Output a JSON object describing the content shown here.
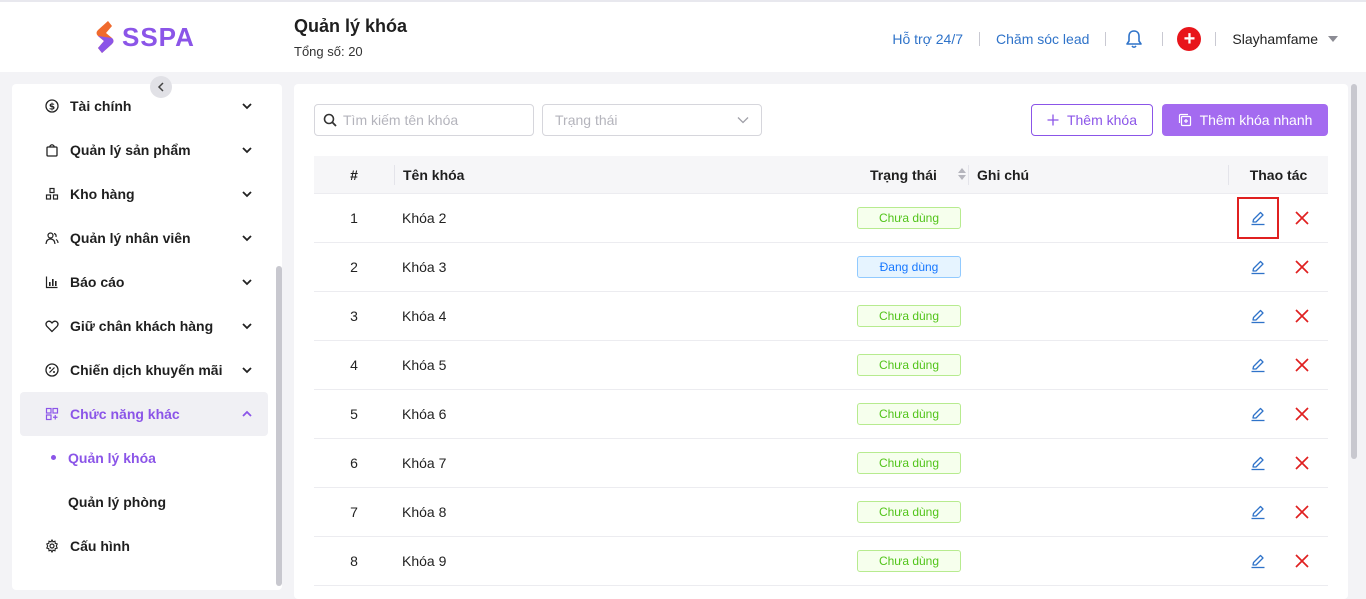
{
  "app": {
    "logo_text": "SSPA",
    "brand_color": "#8b55e8"
  },
  "header": {
    "title": "Quản lý khóa",
    "count_label": "Tổng số: 20",
    "support_link": "Hỗ trợ 24/7",
    "lead_link": "Chăm sóc lead",
    "notification_icon": "bell-icon",
    "add_icon": "plus-circle-icon",
    "user_name": "Slayhamfame"
  },
  "sidebar": {
    "items": [
      {
        "label": "Tài chính",
        "icon": "dollar-icon"
      },
      {
        "label": "Quản lý sản phẩm",
        "icon": "bag-icon"
      },
      {
        "label": "Kho hàng",
        "icon": "boxes-icon"
      },
      {
        "label": "Quản lý nhân viên",
        "icon": "users-icon"
      },
      {
        "label": "Báo cáo",
        "icon": "chart-icon"
      },
      {
        "label": "Giữ chân khách hàng",
        "icon": "heart-icon"
      },
      {
        "label": "Chiến dịch khuyến mãi",
        "icon": "discount-icon"
      },
      {
        "label": "Chức năng khác",
        "icon": "apps-icon",
        "expanded": true
      }
    ],
    "sub_items": [
      {
        "label": "Quản lý khóa",
        "active": true
      },
      {
        "label": "Quản lý phòng",
        "active": false
      }
    ],
    "config": {
      "label": "Cấu hình",
      "icon": "gear-icon"
    }
  },
  "toolbar": {
    "search_placeholder": "Tìm kiếm tên khóa",
    "status_placeholder": "Trạng thái",
    "add_label": "Thêm khóa",
    "quick_add_label": "Thêm khóa nhanh"
  },
  "table": {
    "columns": [
      "#",
      "Tên khóa",
      "Trạng thái",
      "Ghi chú",
      "Thao tác"
    ],
    "rows": [
      {
        "num": "1",
        "name": "Khóa 2",
        "status": "Chưa dùng",
        "note": ""
      },
      {
        "num": "2",
        "name": "Khóa 3",
        "status": "Đang dùng",
        "note": ""
      },
      {
        "num": "3",
        "name": "Khóa 4",
        "status": "Chưa dùng",
        "note": ""
      },
      {
        "num": "4",
        "name": "Khóa 5",
        "status": "Chưa dùng",
        "note": ""
      },
      {
        "num": "5",
        "name": "Khóa 6",
        "status": "Chưa dùng",
        "note": ""
      },
      {
        "num": "6",
        "name": "Khóa 7",
        "status": "Chưa dùng",
        "note": ""
      },
      {
        "num": "7",
        "name": "Khóa 8",
        "status": "Chưa dùng",
        "note": ""
      },
      {
        "num": "8",
        "name": "Khóa 9",
        "status": "Chưa dùng",
        "note": ""
      }
    ]
  },
  "colors": {
    "link": "#2f73c9",
    "danger": "#e8151b",
    "unused_tag": "#52c41a",
    "used_tag": "#1677ff"
  }
}
